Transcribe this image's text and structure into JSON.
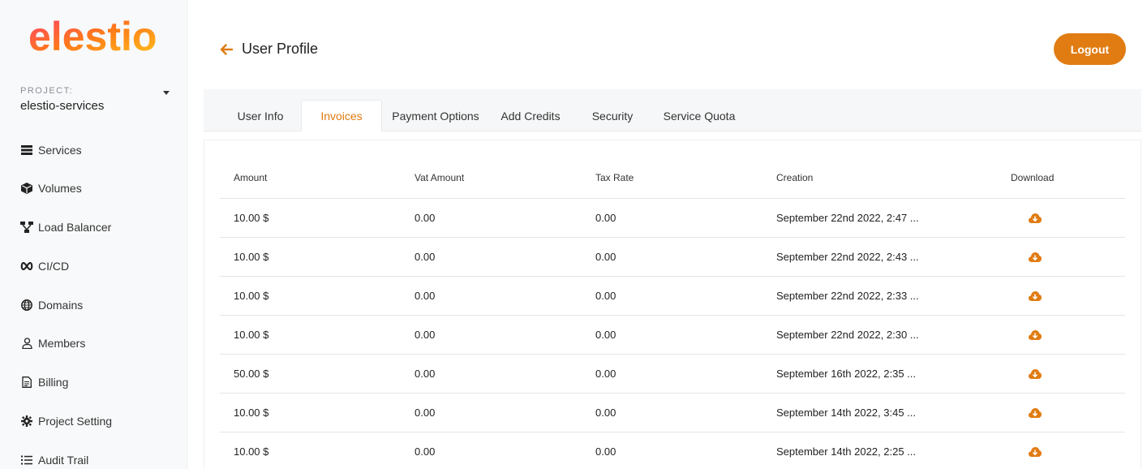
{
  "brand": {
    "logo_text": "elestio",
    "accent": "#e07c12"
  },
  "sidebar": {
    "project_label": "PROJECT:",
    "project_name": "elestio-services",
    "items": [
      {
        "label": "Services",
        "icon": "server-icon"
      },
      {
        "label": "Volumes",
        "icon": "cube-icon"
      },
      {
        "label": "Load Balancer",
        "icon": "network-icon"
      },
      {
        "label": "CI/CD",
        "icon": "infinity-icon"
      },
      {
        "label": "Domains",
        "icon": "globe-icon"
      },
      {
        "label": "Members",
        "icon": "user-icon"
      },
      {
        "label": "Billing",
        "icon": "file-icon"
      },
      {
        "label": "Project Setting",
        "icon": "gear-icon"
      },
      {
        "label": "Audit Trail",
        "icon": "list-icon"
      }
    ]
  },
  "header": {
    "title": "User Profile",
    "logout_label": "Logout"
  },
  "tabs": [
    {
      "label": "User Info",
      "active": false
    },
    {
      "label": "Invoices",
      "active": true
    },
    {
      "label": "Payment Options",
      "active": false
    },
    {
      "label": "Add Credits",
      "active": false
    },
    {
      "label": "Security",
      "active": false
    },
    {
      "label": "Service Quota",
      "active": false
    }
  ],
  "invoices": {
    "columns": [
      "Amount",
      "Vat Amount",
      "Tax Rate",
      "Creation",
      "Download"
    ],
    "rows": [
      {
        "amount": "10.00 $",
        "vat": "0.00",
        "tax": "0.00",
        "creation": "September 22nd 2022, 2:47 ..."
      },
      {
        "amount": "10.00 $",
        "vat": "0.00",
        "tax": "0.00",
        "creation": "September 22nd 2022, 2:43 ..."
      },
      {
        "amount": "10.00 $",
        "vat": "0.00",
        "tax": "0.00",
        "creation": "September 22nd 2022, 2:33 ..."
      },
      {
        "amount": "10.00 $",
        "vat": "0.00",
        "tax": "0.00",
        "creation": "September 22nd 2022, 2:30 ..."
      },
      {
        "amount": "50.00 $",
        "vat": "0.00",
        "tax": "0.00",
        "creation": "September 16th 2022, 2:35 ..."
      },
      {
        "amount": "10.00 $",
        "vat": "0.00",
        "tax": "0.00",
        "creation": "September 14th 2022, 3:45 ..."
      },
      {
        "amount": "10.00 $",
        "vat": "0.00",
        "tax": "0.00",
        "creation": "September 14th 2022, 2:25 ..."
      }
    ]
  }
}
